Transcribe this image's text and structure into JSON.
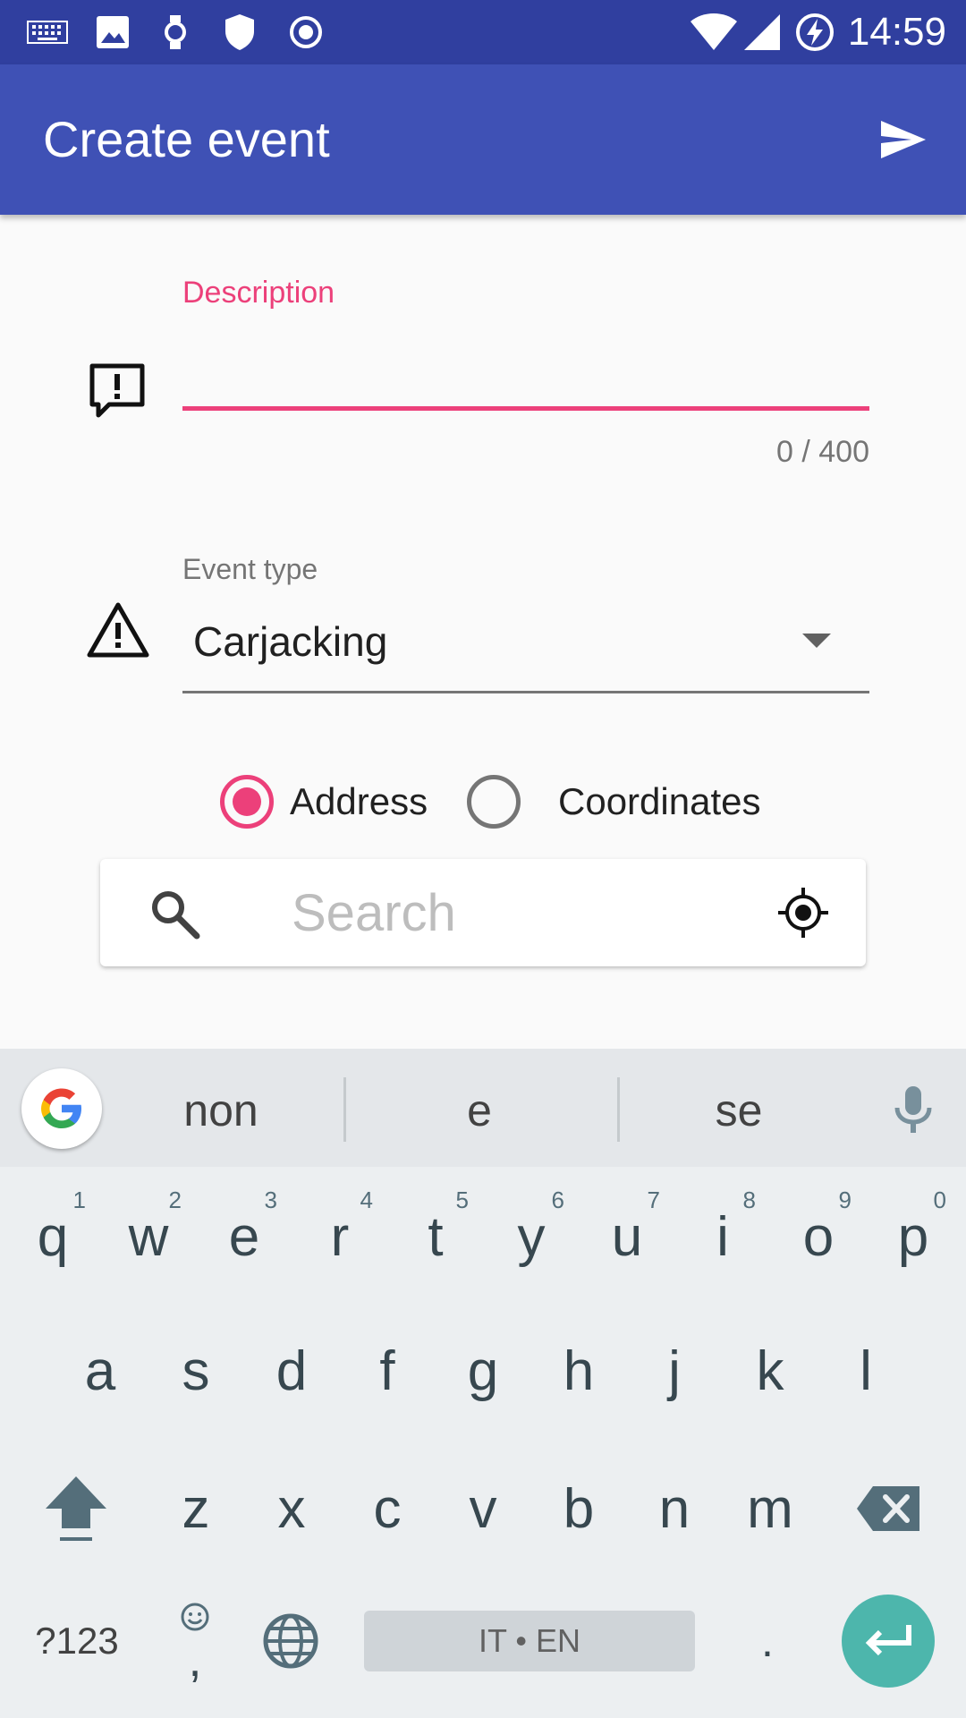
{
  "status_bar": {
    "time": "14:59",
    "icons": [
      "keyboard-icon",
      "image-icon",
      "watch-icon",
      "shield-icon",
      "record-icon",
      "wifi-icon",
      "signal-icon",
      "battery-charging-icon"
    ]
  },
  "app_bar": {
    "title": "Create event",
    "send_icon": "send-icon"
  },
  "form": {
    "description": {
      "label": "Description",
      "value": "",
      "counter": "0 / 400",
      "icon": "feedback-icon"
    },
    "event_type": {
      "label": "Event type",
      "selected": "Carjacking",
      "icon": "warning-icon"
    },
    "location_mode": {
      "options": [
        {
          "label": "Address",
          "checked": true
        },
        {
          "label": "Coordinates",
          "checked": false
        }
      ]
    },
    "search": {
      "placeholder": "Search",
      "value": ""
    }
  },
  "keyboard": {
    "suggestions": [
      "non",
      "e",
      "se"
    ],
    "row1": [
      {
        "key": "q",
        "hint": "1"
      },
      {
        "key": "w",
        "hint": "2"
      },
      {
        "key": "e",
        "hint": "3"
      },
      {
        "key": "r",
        "hint": "4"
      },
      {
        "key": "t",
        "hint": "5"
      },
      {
        "key": "y",
        "hint": "6"
      },
      {
        "key": "u",
        "hint": "7"
      },
      {
        "key": "i",
        "hint": "8"
      },
      {
        "key": "o",
        "hint": "9"
      },
      {
        "key": "p",
        "hint": "0"
      }
    ],
    "row2": [
      "a",
      "s",
      "d",
      "f",
      "g",
      "h",
      "j",
      "k",
      "l"
    ],
    "row3": [
      "z",
      "x",
      "c",
      "v",
      "b",
      "n",
      "m"
    ],
    "symbols_label": "?123",
    "comma_label": ",",
    "space_label": "IT • EN",
    "period_label": ".",
    "accent_color": "#4db6ac"
  },
  "colors": {
    "primary": "#3f51b5",
    "primary_dark": "#303f9f",
    "accent": "#ec407a"
  }
}
